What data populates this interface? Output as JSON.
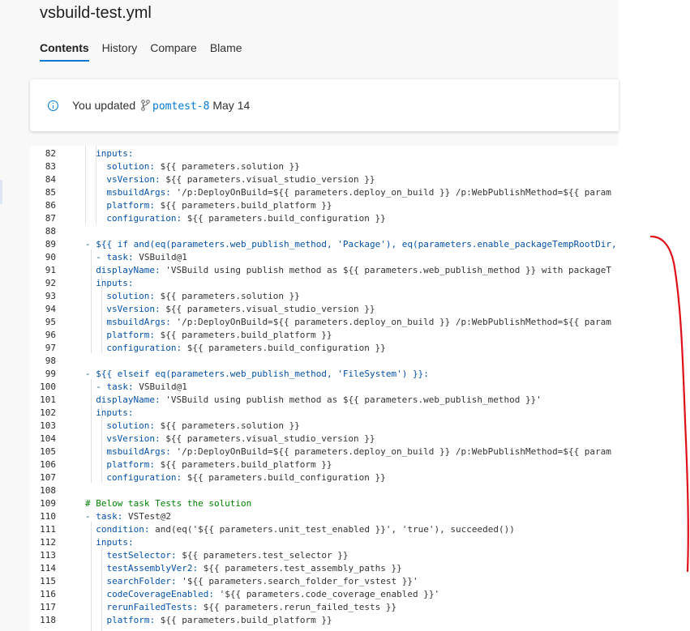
{
  "file": {
    "name": "vsbuild-test.yml"
  },
  "tabs": [
    "Contents",
    "History",
    "Compare",
    "Blame"
  ],
  "banner": {
    "prefix": "You updated",
    "branch": "pomtest-8",
    "date": "May 14"
  },
  "code_lines": [
    {
      "n": "82",
      "indent": 1,
      "key": "inputs:",
      "rest": ""
    },
    {
      "n": "83",
      "indent": 2,
      "key": "solution:",
      "rest": " ${{ parameters.solution }}"
    },
    {
      "n": "84",
      "indent": 2,
      "key": "vsVersion:",
      "rest": " ${{ parameters.visual_studio_version }}"
    },
    {
      "n": "85",
      "indent": 2,
      "key": "msbuildArgs:",
      "rest": " '/p:DeployOnBuild=${{ parameters.deploy_on_build }} /p:WebPublishMethod=${{ param"
    },
    {
      "n": "86",
      "indent": 2,
      "key": "platform:",
      "rest": " ${{ parameters.build_platform }}"
    },
    {
      "n": "87",
      "indent": 2,
      "key": "configuration:",
      "rest": " ${{ parameters.build_configuration }}"
    },
    {
      "n": "88",
      "indent": 0,
      "key": "",
      "rest": ""
    },
    {
      "n": "89",
      "indent": 0,
      "key": "- ${{ if and(eq(parameters.web_publish_method, 'Package'), eq(parameters.enable_packageTempRootDir,",
      "rest": ""
    },
    {
      "n": "90",
      "indent": 0,
      "key": "  - task:",
      "rest": " VSBuild@1"
    },
    {
      "n": "91",
      "indent": 1,
      "key": "displayName:",
      "rest": " 'VSBuild using publish method as ${{ parameters.web_publish_method }} with packageT"
    },
    {
      "n": "92",
      "indent": 1,
      "key": "inputs:",
      "rest": ""
    },
    {
      "n": "93",
      "indent": 2,
      "key": "solution:",
      "rest": " ${{ parameters.solution }}"
    },
    {
      "n": "94",
      "indent": 2,
      "key": "vsVersion:",
      "rest": " ${{ parameters.visual_studio_version }}"
    },
    {
      "n": "95",
      "indent": 2,
      "key": "msbuildArgs:",
      "rest": " '/p:DeployOnBuild=${{ parameters.deploy_on_build }} /p:WebPublishMethod=${{ param"
    },
    {
      "n": "96",
      "indent": 2,
      "key": "platform:",
      "rest": " ${{ parameters.build_platform }}"
    },
    {
      "n": "97",
      "indent": 2,
      "key": "configuration:",
      "rest": " ${{ parameters.build_configuration }}"
    },
    {
      "n": "98",
      "indent": 0,
      "key": "",
      "rest": ""
    },
    {
      "n": "99",
      "indent": 0,
      "key": "- ${{ elseif eq(parameters.web_publish_method, 'FileSystem') }}:",
      "rest": ""
    },
    {
      "n": "100",
      "indent": 0,
      "key": "  - task:",
      "rest": " VSBuild@1"
    },
    {
      "n": "101",
      "indent": 1,
      "key": "displayName:",
      "rest": " 'VSBuild using publish method as ${{ parameters.web_publish_method }}'"
    },
    {
      "n": "102",
      "indent": 1,
      "key": "inputs:",
      "rest": ""
    },
    {
      "n": "103",
      "indent": 2,
      "key": "solution:",
      "rest": " ${{ parameters.solution }}"
    },
    {
      "n": "104",
      "indent": 2,
      "key": "vsVersion:",
      "rest": " ${{ parameters.visual_studio_version }}"
    },
    {
      "n": "105",
      "indent": 2,
      "key": "msbuildArgs:",
      "rest": " '/p:DeployOnBuild=${{ parameters.deploy_on_build }} /p:WebPublishMethod=${{ param"
    },
    {
      "n": "106",
      "indent": 2,
      "key": "platform:",
      "rest": " ${{ parameters.build_platform }}"
    },
    {
      "n": "107",
      "indent": 2,
      "key": "configuration:",
      "rest": " ${{ parameters.build_configuration }}"
    },
    {
      "n": "108",
      "indent": 0,
      "key": "",
      "rest": ""
    },
    {
      "n": "109",
      "indent": 0,
      "key": "# Below task Tests the solution",
      "rest": "",
      "comment": true
    },
    {
      "n": "110",
      "indent": 0,
      "key": "- task:",
      "rest": " VSTest@2"
    },
    {
      "n": "111",
      "indent": 0,
      "key": "  condition:",
      "rest": " and(eq('${{ parameters.unit_test_enabled }}', 'true'), succeeded())"
    },
    {
      "n": "112",
      "indent": 0,
      "key": "  inputs:",
      "rest": ""
    },
    {
      "n": "113",
      "indent": 0,
      "key": "    testSelector:",
      "rest": " ${{ parameters.test_selector }}"
    },
    {
      "n": "114",
      "indent": 0,
      "key": "    testAssemblyVer2:",
      "rest": " ${{ parameters.test_assembly_paths }}"
    },
    {
      "n": "115",
      "indent": 0,
      "key": "    searchFolder:",
      "rest": " '${{ parameters.search_folder_for_vstest }}'"
    },
    {
      "n": "116",
      "indent": 0,
      "key": "    codeCoverageEnabled:",
      "rest": " '${{ parameters.code_coverage_enabled }}'"
    },
    {
      "n": "117",
      "indent": 0,
      "key": "    rerunFailedTests:",
      "rest": " ${{ parameters.rerun_failed_tests }}"
    },
    {
      "n": "118",
      "indent": 0,
      "key": "    platform:",
      "rest": " ${{ parameters.build_platform }}"
    }
  ],
  "colors": {
    "accent": "#0078d4",
    "key": "#0451a5",
    "comment": "#008000",
    "annotation": "#e0101a"
  }
}
